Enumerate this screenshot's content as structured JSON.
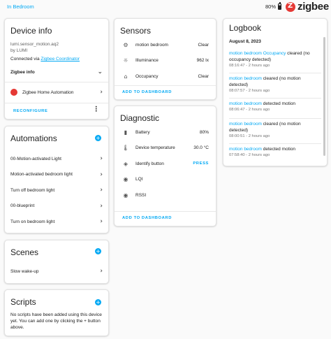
{
  "topbar": {
    "back_label": "In Bedroom",
    "battery_pct": "80%",
    "brand": "zigbee"
  },
  "device_info": {
    "title": "Device info",
    "model": "lumi.sensor_motion.aq2",
    "manufacturer": "by LUMI",
    "connected_prefix": "Connected via ",
    "connected_link": "Zigbee Coordinator",
    "zigbee_info_label": "Zigbee info",
    "integration_label": "Zigbee Home Automation",
    "reconfigure_label": "RECONFIGURE"
  },
  "automations": {
    "title": "Automations",
    "items": [
      "00-Motion-activated Light",
      "Motion-activated bedroom light",
      "Turn off bedroom light",
      "00-blueprint",
      "Turn on bedroom light"
    ]
  },
  "scenes": {
    "title": "Scenes",
    "items": [
      "Slow wake-up"
    ]
  },
  "scripts": {
    "title": "Scripts",
    "empty_text": "No scripts have been added using this device yet. You can add one by clicking the + button above."
  },
  "sensors": {
    "title": "Sensors",
    "rows": [
      {
        "icon": "motion-sensor-icon",
        "label": "motion bedroom",
        "value": "Clear"
      },
      {
        "icon": "brightness-icon",
        "label": "Illuminance",
        "value": "962 lx"
      },
      {
        "icon": "home-icon",
        "label": "Occupancy",
        "value": "Clear"
      }
    ],
    "add_label": "ADD TO DASHBOARD"
  },
  "diagnostic": {
    "title": "Diagnostic",
    "rows": [
      {
        "icon": "battery-icon",
        "label": "Battery",
        "value": "80%"
      },
      {
        "icon": "thermometer-icon",
        "label": "Device temperature",
        "value": "30.0 °C"
      },
      {
        "icon": "identify-icon",
        "label": "Identify button",
        "value": "PRESS"
      },
      {
        "icon": "eye-icon",
        "label": "LQI",
        "value": ""
      },
      {
        "icon": "eye-icon",
        "label": "RSSI",
        "value": ""
      }
    ],
    "add_label": "ADD TO DASHBOARD"
  },
  "logbook": {
    "title": "Logbook",
    "date": "August 8, 2023",
    "entries": [
      {
        "entity": "motion bedroom",
        "entity2": "Occupancy",
        "text_line1": " cleared (no",
        "text_line2": "occupancy detected)",
        "time": "08:16:47 - 2 hours ago"
      },
      {
        "entity": "motion bedroom",
        "text_line1": " cleared (no motion",
        "text_line2": "detected)",
        "time": "08:07:57 - 2 hours ago"
      },
      {
        "entity": "motion bedroom",
        "text_line1": " detected motion",
        "text_line2": "",
        "time": "08:06:47 - 2 hours ago"
      },
      {
        "entity": "motion bedroom",
        "text_line1": " cleared (no motion",
        "text_line2": "detected)",
        "time": "08:00:51 - 2 hours ago"
      },
      {
        "entity": "motion bedroom",
        "text_line1": " detected motion",
        "text_line2": "",
        "time": "07:58:40 - 2 hours ago"
      }
    ]
  },
  "colors": {
    "accent": "#03a9f4",
    "brand_red": "#e53935"
  }
}
